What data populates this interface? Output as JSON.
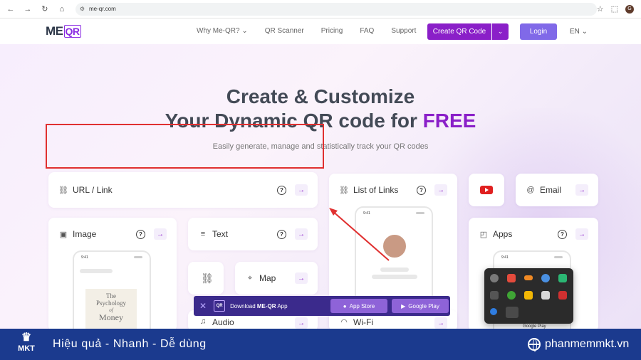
{
  "browser": {
    "url": "me-qr.com",
    "profile_initial": "G",
    "back_icon": "arrow-left-icon",
    "forward_icon": "arrow-right-icon"
  },
  "header": {
    "logo_text": "ME",
    "logo_qr": "QR",
    "nav": [
      "Why Me-QR? ⌄",
      "QR Scanner",
      "Pricing",
      "FAQ",
      "Support"
    ],
    "create_label": "Create QR Code",
    "login_label": "Login",
    "lang": "EN ⌄"
  },
  "hero": {
    "title_line1": "Create & Customize",
    "title_line2": "Your Dynamic QR code for ",
    "title_highlight": "FREE",
    "subtitle": "Easily generate, manage and statistically track your QR codes"
  },
  "cards": {
    "url_link": "URL / Link",
    "list_of_links": "List of Links",
    "email": "Email",
    "image": "Image",
    "text": "Text",
    "apps": "Apps",
    "map": "Map",
    "audio": "Audio",
    "wifi": "Wi-Fi",
    "help_symbol": "?",
    "arrow_symbol": "→",
    "phone_time": "9:41",
    "book_title_1": "The",
    "book_title_2": "Psychology",
    "book_title_3": "of",
    "book_title_4": "Money",
    "google_play_mini": "Google Play"
  },
  "download_banner": {
    "close": "✕",
    "logo": "QR",
    "text_prefix": "Download ",
    "text_brand": "ME-QR",
    "text_suffix": " App",
    "app_store": "App Store",
    "google_play": "Google Play"
  },
  "footer": {
    "brand": "MKT",
    "slogan": "Hiệu quả - Nhanh - Dễ dùng",
    "site": "phanmemmkt.vn"
  },
  "colors": {
    "brand_purple": "#8a1fc8",
    "login_purple": "#8069e8",
    "annotation_red": "#e03030",
    "footer_blue": "#1b3a8e",
    "banner_navy": "#3b2a8c"
  }
}
